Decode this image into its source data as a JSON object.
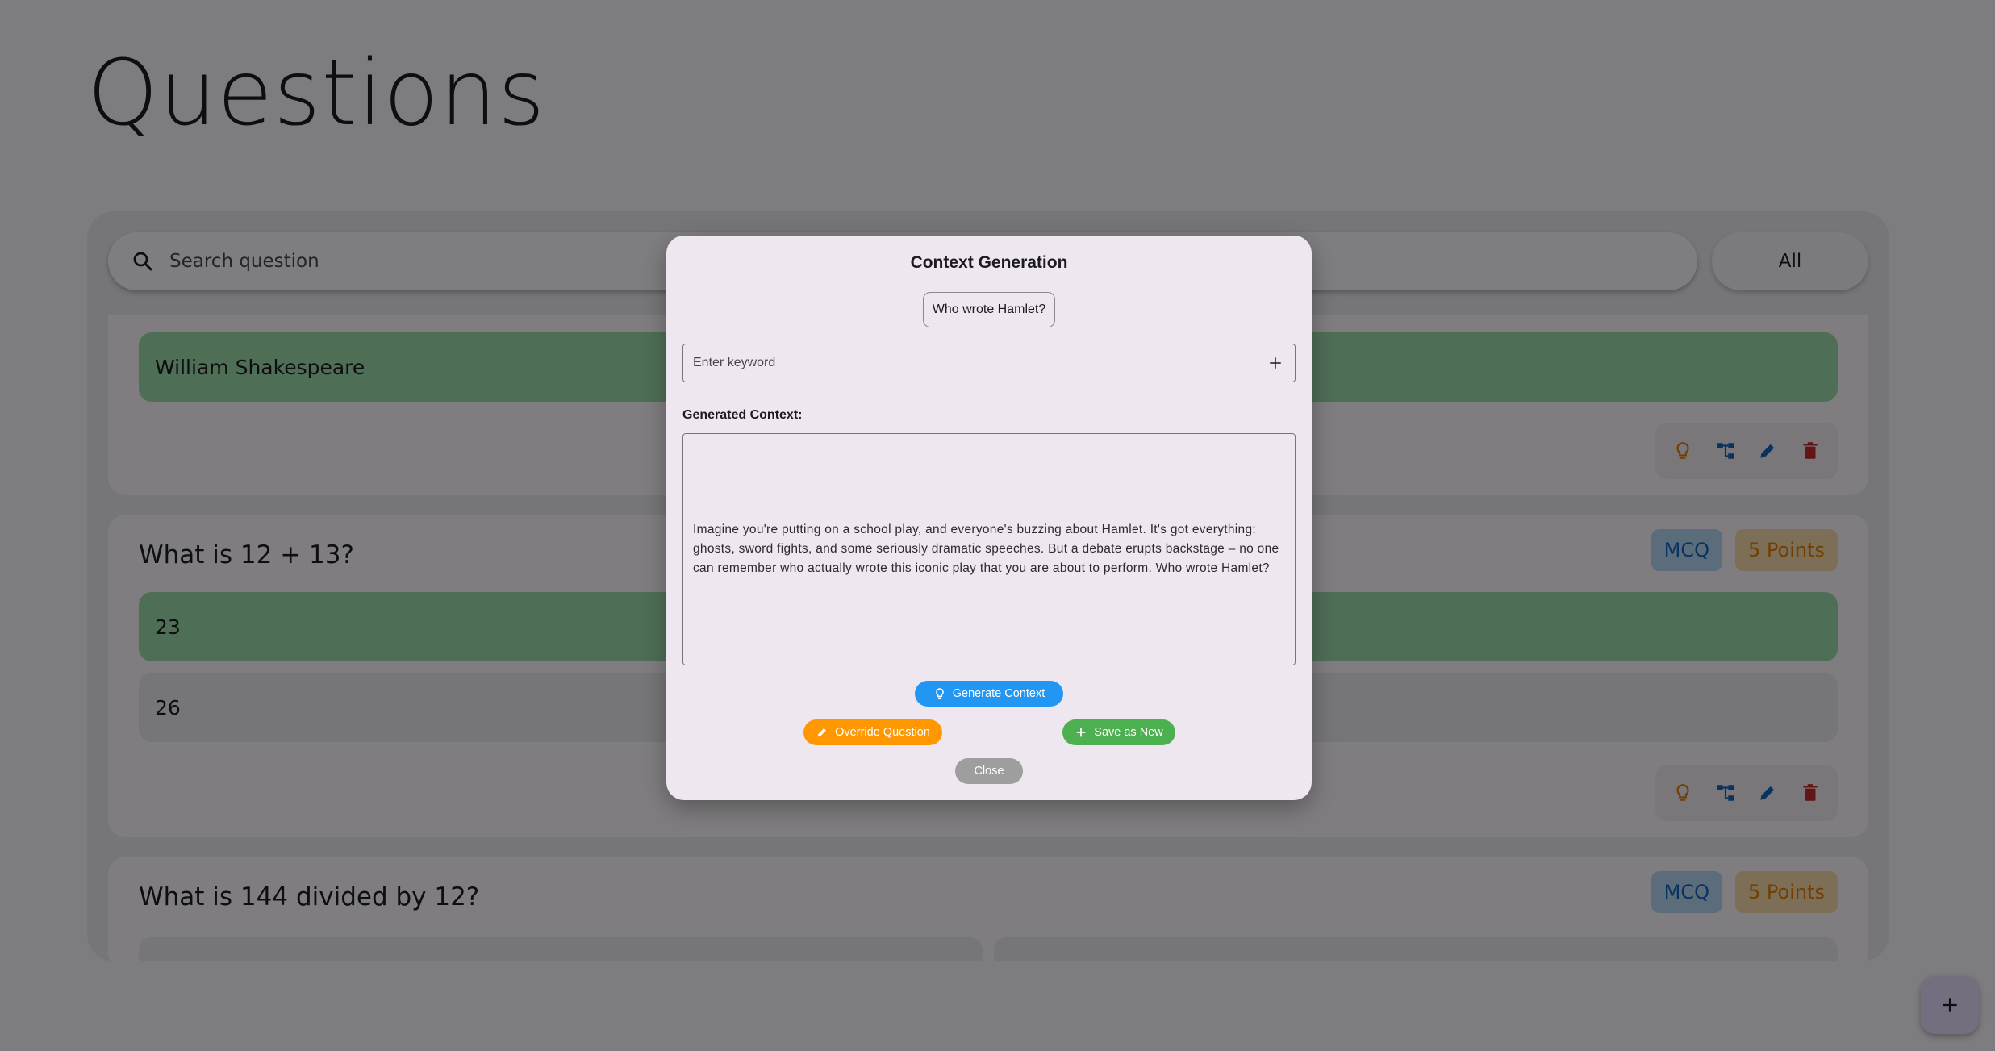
{
  "page": {
    "title": "Questions"
  },
  "search": {
    "placeholder": "Search question"
  },
  "filter": {
    "label": "All"
  },
  "questions": [
    {
      "options": [
        {
          "text": "William Shakespeare",
          "correct": true
        }
      ]
    },
    {
      "title": "What is 12 + 13?",
      "type_badge": "MCQ",
      "points_badge": "5 Points",
      "options": [
        {
          "text": "23",
          "correct": true
        },
        {
          "text": "26",
          "correct": false
        }
      ]
    },
    {
      "title": "What is 144 divided by 12?",
      "type_badge": "MCQ",
      "points_badge": "5 Points"
    }
  ],
  "dialog": {
    "title": "Context Generation",
    "question_chip": "Who wrote Hamlet?",
    "keyword_placeholder": "Enter keyword",
    "generated_label": "Generated Context:",
    "generated_text": "Imagine you're putting on a school play, and everyone's buzzing about Hamlet. It's got everything: ghosts, sword fights, and some seriously dramatic speeches. But a debate erupts backstage – no one can remember who actually wrote this iconic play that you are about to perform. Who wrote Hamlet?",
    "buttons": {
      "generate": "Generate Context",
      "override": "Override Question",
      "save_new": "Save as New",
      "close": "Close"
    }
  },
  "colors": {
    "correct_option": "#9fdcac",
    "generate": "#2196f3",
    "override": "#ff9800",
    "save_new": "#4caf50",
    "close": "#9e9e9e",
    "hint_icon": "#e67e00",
    "tree_icon": "#1565c0",
    "edit_icon": "#1565c0",
    "delete_icon": "#c62828"
  },
  "icons": {
    "search": "search-icon",
    "hint": "lightbulb-icon",
    "tree": "account-tree-icon",
    "edit": "pencil-icon",
    "delete": "trash-icon",
    "add": "plus-icon"
  }
}
